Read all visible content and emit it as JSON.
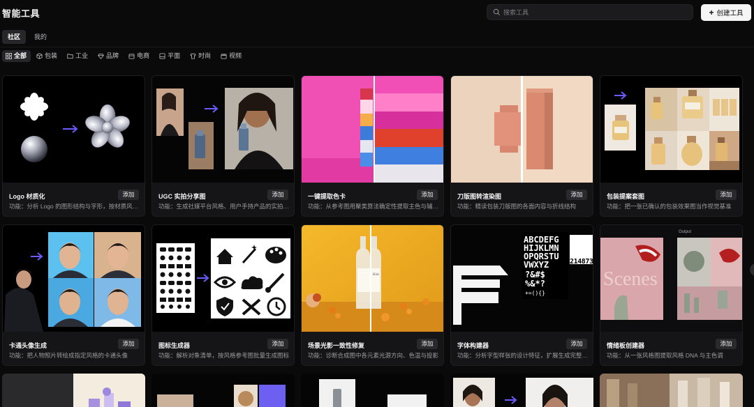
{
  "header": {
    "app_title": "智能工具",
    "search_placeholder": "搜索工具",
    "create_label": "创建工具"
  },
  "tabs": [
    {
      "label": "社区",
      "active": true
    },
    {
      "label": "我的",
      "active": false
    }
  ],
  "filters": [
    {
      "label": "全部",
      "icon": "grid-icon",
      "active": true
    },
    {
      "label": "包装",
      "icon": "package-icon"
    },
    {
      "label": "工业",
      "icon": "folder-icon"
    },
    {
      "label": "品牌",
      "icon": "diamond-icon"
    },
    {
      "label": "电商",
      "icon": "shop-icon"
    },
    {
      "label": "平面",
      "icon": "layout-icon"
    },
    {
      "label": "时尚",
      "icon": "shirt-icon"
    },
    {
      "label": "视频",
      "icon": "video-icon"
    }
  ],
  "add_label": "添加",
  "cards": [
    {
      "title": "Logo 材质化",
      "desc": "功能：分析 Logo 的图形结构与字形，按材质风格重塑"
    },
    {
      "title": "UGC 实拍分享图",
      "desc": "功能：生成社媒平台风格、用户手持产品的实拍分享图"
    },
    {
      "title": "一键提取色卡",
      "desc": "功能：从参考图用聚类算法确定性提取主色与辅助色"
    },
    {
      "title": "刀版图转渲染图",
      "desc": "功能：精读包装刀版图的各面内容与折线结构"
    },
    {
      "title": "包装提案套图",
      "desc": "功能：把一张已确认的包装效果图当作视觉基准"
    },
    {
      "title": "卡通头像生成",
      "desc": "功能：把人物照片转绘成指定风格的卡通头像"
    },
    {
      "title": "图标生成器",
      "desc": "功能：解析对象清单，按风格参考图批量生成图标"
    },
    {
      "title": "场景光影一致性修复",
      "desc": "功能：诊断合成图中各元素光源方向、色温与投影"
    },
    {
      "title": "字体构建器",
      "desc": "功能：分析字型样张的设计特征，扩展生成完整字符集"
    },
    {
      "title": "情绪板创建器",
      "desc": "功能：从一张风格图提取风格 DNA 与主色调"
    }
  ],
  "thumb_text": {
    "output_label": "Output",
    "scene_word": "Scenes",
    "font_glyphs_1": "ABCDEFG",
    "font_glyphs_2": "HIJKLMN",
    "font_glyphs_3": "OPQRSTU",
    "font_glyphs_4": "VWXYZ",
    "font_glyphs_5": "?&#$",
    "font_glyphs_6": "%&*?",
    "font_glyphs_7": "+=(){}",
    "font_digits": "2 1 4 8 7 3",
    "bottle_label": "Birk"
  },
  "colors": {
    "accent_arrow": "#6b5cff",
    "background": "#0a0a0b",
    "card_bg": "#151517"
  }
}
